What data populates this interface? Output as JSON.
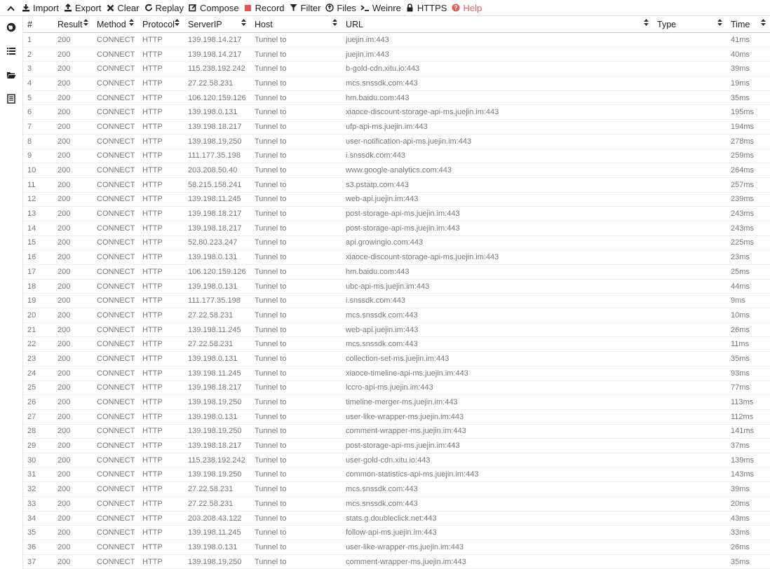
{
  "toolbar": {
    "items": [
      {
        "label": "Import",
        "icon": "import-icon"
      },
      {
        "label": "Export",
        "icon": "export-icon"
      },
      {
        "label": "Clear",
        "icon": "clear-icon"
      },
      {
        "label": "Replay",
        "icon": "replay-icon"
      },
      {
        "label": "Compose",
        "icon": "compose-icon"
      },
      {
        "label": "Record",
        "icon": "record-icon",
        "color": "#e55353"
      },
      {
        "label": "Filter",
        "icon": "filter-icon"
      },
      {
        "label": "Files",
        "icon": "files-icon"
      },
      {
        "label": "Weinre",
        "icon": "weinre-icon"
      },
      {
        "label": "HTTPS",
        "icon": "lock-icon"
      },
      {
        "label": "Help",
        "icon": "help-icon",
        "color": "#e06060"
      }
    ]
  },
  "sidebar": [
    "network-icon",
    "rules-icon",
    "folder-icon",
    "values-icon"
  ],
  "columns": [
    "#",
    "Result",
    "Method",
    "Protocol",
    "ServerIP",
    "Host",
    "URL",
    "Type",
    "Time"
  ],
  "rows": [
    [
      "1",
      "200",
      "CONNECT",
      "HTTP",
      "139.198.14.217",
      "Tunnel to",
      "juejin.im:443",
      "",
      "41ms"
    ],
    [
      "2",
      "200",
      "CONNECT",
      "HTTP",
      "139.198.14.217",
      "Tunnel to",
      "juejin.im:443",
      "",
      "40ms"
    ],
    [
      "3",
      "200",
      "CONNECT",
      "HTTP",
      "115.238.192.242",
      "Tunnel to",
      "b-gold-cdn.xitu.io:443",
      "",
      "39ms"
    ],
    [
      "4",
      "200",
      "CONNECT",
      "HTTP",
      "27.22.58.231",
      "Tunnel to",
      "mcs.snssdk.com:443",
      "",
      "19ms"
    ],
    [
      "5",
      "200",
      "CONNECT",
      "HTTP",
      "106.120.159.126",
      "Tunnel to",
      "hm.baidu.com:443",
      "",
      "35ms"
    ],
    [
      "6",
      "200",
      "CONNECT",
      "HTTP",
      "139.198.0.131",
      "Tunnel to",
      "xiaoce-discount-storage-api-ms.juejin.im:443",
      "",
      "195ms"
    ],
    [
      "7",
      "200",
      "CONNECT",
      "HTTP",
      "139.198.18.217",
      "Tunnel to",
      "ufp-api-ms.juejin.im:443",
      "",
      "194ms"
    ],
    [
      "8",
      "200",
      "CONNECT",
      "HTTP",
      "139.198.19.250",
      "Tunnel to",
      "user-notification-api-ms.juejin.im:443",
      "",
      "278ms"
    ],
    [
      "9",
      "200",
      "CONNECT",
      "HTTP",
      "111.177.35.198",
      "Tunnel to",
      "i.snssdk.com:443",
      "",
      "259ms"
    ],
    [
      "10",
      "200",
      "CONNECT",
      "HTTP",
      "203.208.50.40",
      "Tunnel to",
      "www.google-analytics.com:443",
      "",
      "264ms"
    ],
    [
      "11",
      "200",
      "CONNECT",
      "HTTP",
      "58.215.158.241",
      "Tunnel to",
      "s3.pstatp.com:443",
      "",
      "257ms"
    ],
    [
      "12",
      "200",
      "CONNECT",
      "HTTP",
      "139.198.11.245",
      "Tunnel to",
      "web-api.juejin.im:443",
      "",
      "239ms"
    ],
    [
      "13",
      "200",
      "CONNECT",
      "HTTP",
      "139.198.18.217",
      "Tunnel to",
      "post-storage-api-ms.juejin.im:443",
      "",
      "243ms"
    ],
    [
      "14",
      "200",
      "CONNECT",
      "HTTP",
      "139.198.18.217",
      "Tunnel to",
      "post-storage-api-ms.juejin.im:443",
      "",
      "243ms"
    ],
    [
      "15",
      "200",
      "CONNECT",
      "HTTP",
      "52.80.223.247",
      "Tunnel to",
      "api.growingio.com:443",
      "",
      "225ms"
    ],
    [
      "16",
      "200",
      "CONNECT",
      "HTTP",
      "139.198.0.131",
      "Tunnel to",
      "xiaoce-discount-storage-api-ms.juejin.im:443",
      "",
      "23ms"
    ],
    [
      "17",
      "200",
      "CONNECT",
      "HTTP",
      "106.120.159.126",
      "Tunnel to",
      "hm.baidu.com:443",
      "",
      "25ms"
    ],
    [
      "18",
      "200",
      "CONNECT",
      "HTTP",
      "139.198.0.131",
      "Tunnel to",
      "ubc-api-ms.juejin.im:443",
      "",
      "44ms"
    ],
    [
      "19",
      "200",
      "CONNECT",
      "HTTP",
      "111.177.35.198",
      "Tunnel to",
      "i.snssdk.com:443",
      "",
      "9ms"
    ],
    [
      "20",
      "200",
      "CONNECT",
      "HTTP",
      "27.22.58.231",
      "Tunnel to",
      "mcs.snssdk.com:443",
      "",
      "10ms"
    ],
    [
      "21",
      "200",
      "CONNECT",
      "HTTP",
      "139.198.11.245",
      "Tunnel to",
      "web-api.juejin.im:443",
      "",
      "26ms"
    ],
    [
      "22",
      "200",
      "CONNECT",
      "HTTP",
      "27.22.58.231",
      "Tunnel to",
      "mcs.snssdk.com:443",
      "",
      "11ms"
    ],
    [
      "23",
      "200",
      "CONNECT",
      "HTTP",
      "139.198.0.131",
      "Tunnel to",
      "collection-set-ms.juejin.im:443",
      "",
      "35ms"
    ],
    [
      "24",
      "200",
      "CONNECT",
      "HTTP",
      "139.198.11.245",
      "Tunnel to",
      "xiaoce-timeline-api-ms.juejin.im:443",
      "",
      "93ms"
    ],
    [
      "25",
      "200",
      "CONNECT",
      "HTTP",
      "139.198.18.217",
      "Tunnel to",
      "lccro-api-ms.juejin.im:443",
      "",
      "77ms"
    ],
    [
      "26",
      "200",
      "CONNECT",
      "HTTP",
      "139.198.19.250",
      "Tunnel to",
      "timeline-merger-ms.juejin.im:443",
      "",
      "113ms"
    ],
    [
      "27",
      "200",
      "CONNECT",
      "HTTP",
      "139.198.0.131",
      "Tunnel to",
      "user-like-wrapper-ms.juejin.im:443",
      "",
      "112ms"
    ],
    [
      "28",
      "200",
      "CONNECT",
      "HTTP",
      "139.198.19.250",
      "Tunnel to",
      "comment-wrapper-ms.juejin.im:443",
      "",
      "141ms"
    ],
    [
      "29",
      "200",
      "CONNECT",
      "HTTP",
      "139.198.18.217",
      "Tunnel to",
      "post-storage-api-ms.juejin.im:443",
      "",
      "37ms"
    ],
    [
      "30",
      "200",
      "CONNECT",
      "HTTP",
      "115.238.192.242",
      "Tunnel to",
      "user-gold-cdn.xitu.io:443",
      "",
      "139ms"
    ],
    [
      "31",
      "200",
      "CONNECT",
      "HTTP",
      "139.198.19.250",
      "Tunnel to",
      "common-statistics-api-ms.juejin.im:443",
      "",
      "143ms"
    ],
    [
      "32",
      "200",
      "CONNECT",
      "HTTP",
      "27.22.58.231",
      "Tunnel to",
      "mcs.snssdk.com:443",
      "",
      "39ms"
    ],
    [
      "33",
      "200",
      "CONNECT",
      "HTTP",
      "27.22.58.231",
      "Tunnel to",
      "mcs.snssdk.com:443",
      "",
      "20ms"
    ],
    [
      "34",
      "200",
      "CONNECT",
      "HTTP",
      "203.208.43.122",
      "Tunnel to",
      "stats.g.doubleclick.net:443",
      "",
      "43ms"
    ],
    [
      "35",
      "200",
      "CONNECT",
      "HTTP",
      "139.198.11.245",
      "Tunnel to",
      "follow-api-ms.juejin.im:443",
      "",
      "33ms"
    ],
    [
      "36",
      "200",
      "CONNECT",
      "HTTP",
      "139.198.0.131",
      "Tunnel to",
      "user-like-wrapper-ms.juejin.im:443",
      "",
      "26ms"
    ],
    [
      "37",
      "200",
      "CONNECT",
      "HTTP",
      "139.198.19.250",
      "Tunnel to",
      "comment-wrapper-ms.juejin.im:443",
      "",
      "35ms"
    ]
  ]
}
